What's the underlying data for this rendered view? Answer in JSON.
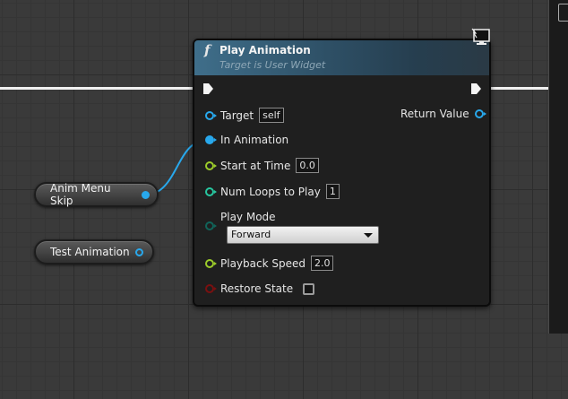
{
  "graph": {
    "variables": [
      {
        "label": "Anim Menu Skip"
      },
      {
        "label": "Test Animation"
      }
    ]
  },
  "node": {
    "title": "Play Animation",
    "subtitle": "Target is User Widget",
    "function_icon": "f",
    "inputs": {
      "target": {
        "label": "Target",
        "value": "self"
      },
      "in_animation": {
        "label": "In Animation"
      },
      "start_at_time": {
        "label": "Start at Time",
        "value": "0.0"
      },
      "num_loops": {
        "label": "Num Loops to Play",
        "value": "1"
      },
      "play_mode": {
        "label": "Play Mode",
        "selected": "Forward"
      },
      "playback_speed": {
        "label": "Playback Speed",
        "value": "2.0"
      },
      "restore_state": {
        "label": "Restore State",
        "checked": false
      }
    },
    "outputs": {
      "return_value": {
        "label": "Return Value"
      }
    }
  },
  "colors": {
    "object_pin": "#28a8ec",
    "float_pin": "#9ccc2a",
    "int_pin": "#27c7a0",
    "enum_pin": "#11645a",
    "bool_pin": "#7a1010",
    "exec": "#f0f0f0"
  },
  "icons": [
    "function-icon",
    "monitor-icon",
    "exec-pin-icon",
    "dropdown-caret-icon"
  ]
}
